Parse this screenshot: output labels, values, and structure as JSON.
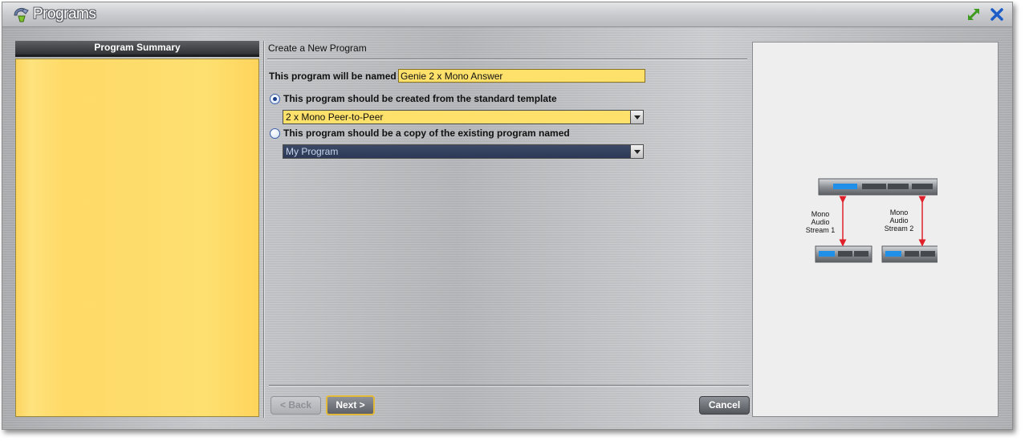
{
  "window": {
    "title": "Programs",
    "expand_icon": "expand-arrow-icon",
    "close_icon": "close-x-icon"
  },
  "summary": {
    "header": "Program Summary"
  },
  "form": {
    "section_title": "Create a New Program",
    "name_label": "This program will be named",
    "name_value": "Genie 2 x Mono Answer",
    "template_option_label": "This program should be created from the standard template",
    "template_selected": "2 x Mono Peer-to-Peer",
    "copy_option_label": "This program should be a copy of the existing program named",
    "copy_selected": "My Program",
    "selected_option": "template"
  },
  "buttons": {
    "back": "< Back",
    "next": "Next >",
    "cancel": "Cancel"
  },
  "preview": {
    "stream1_lines": [
      "Mono",
      "Audio",
      "Stream 1"
    ],
    "stream2_lines": [
      "Mono",
      "Audio",
      "Stream 2"
    ]
  },
  "colors": {
    "summary_bg": "#fedc6c",
    "input_bg": "#fde16a",
    "next_border": "#e3b93a",
    "arrow_red": "#e0202a",
    "led_blue": "#1f8fe8"
  }
}
